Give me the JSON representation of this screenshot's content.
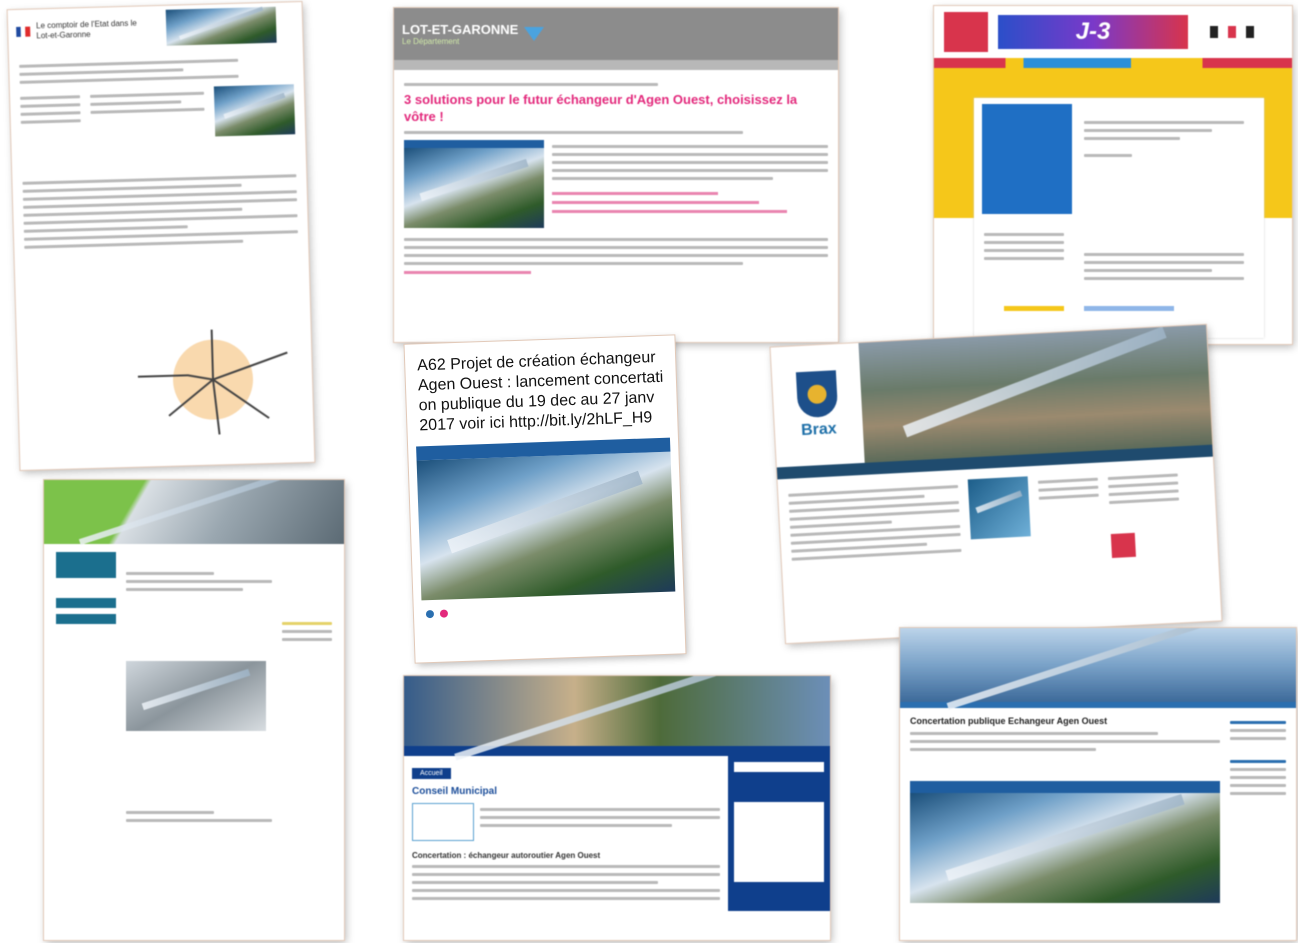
{
  "card1": {
    "title": "Le comptoir de l'Etat dans le Lot-et-Garonne"
  },
  "card2": {
    "brand": "LOT-ET-GARONNE",
    "tagline": "Le Département",
    "headline": "3 solutions pour le futur échangeur d'Agen Ouest, choisissez la vôtre !"
  },
  "card3": {
    "countdown": "J-3"
  },
  "card4": {
    "tweet": "A62 Projet de création échangeur Agen Ouest : lancement concertation publique du 19 dec au 27 janv 2017 voir ici http://bit.ly/2hLF_H9"
  },
  "card5": {
    "town": "Brax"
  },
  "card6": {
    "section": "Conseil Municipal",
    "article": "Concertation : échangeur autoroutier Agen Ouest",
    "tab": "Accueil"
  },
  "card7": {
    "title": "Concertation publique Echangeur Agen Ouest"
  },
  "colors": {
    "pink": "#e3297c",
    "blue": "#1f5ea0",
    "yellow": "#f5c71a",
    "teal": "#1b6f8e"
  }
}
